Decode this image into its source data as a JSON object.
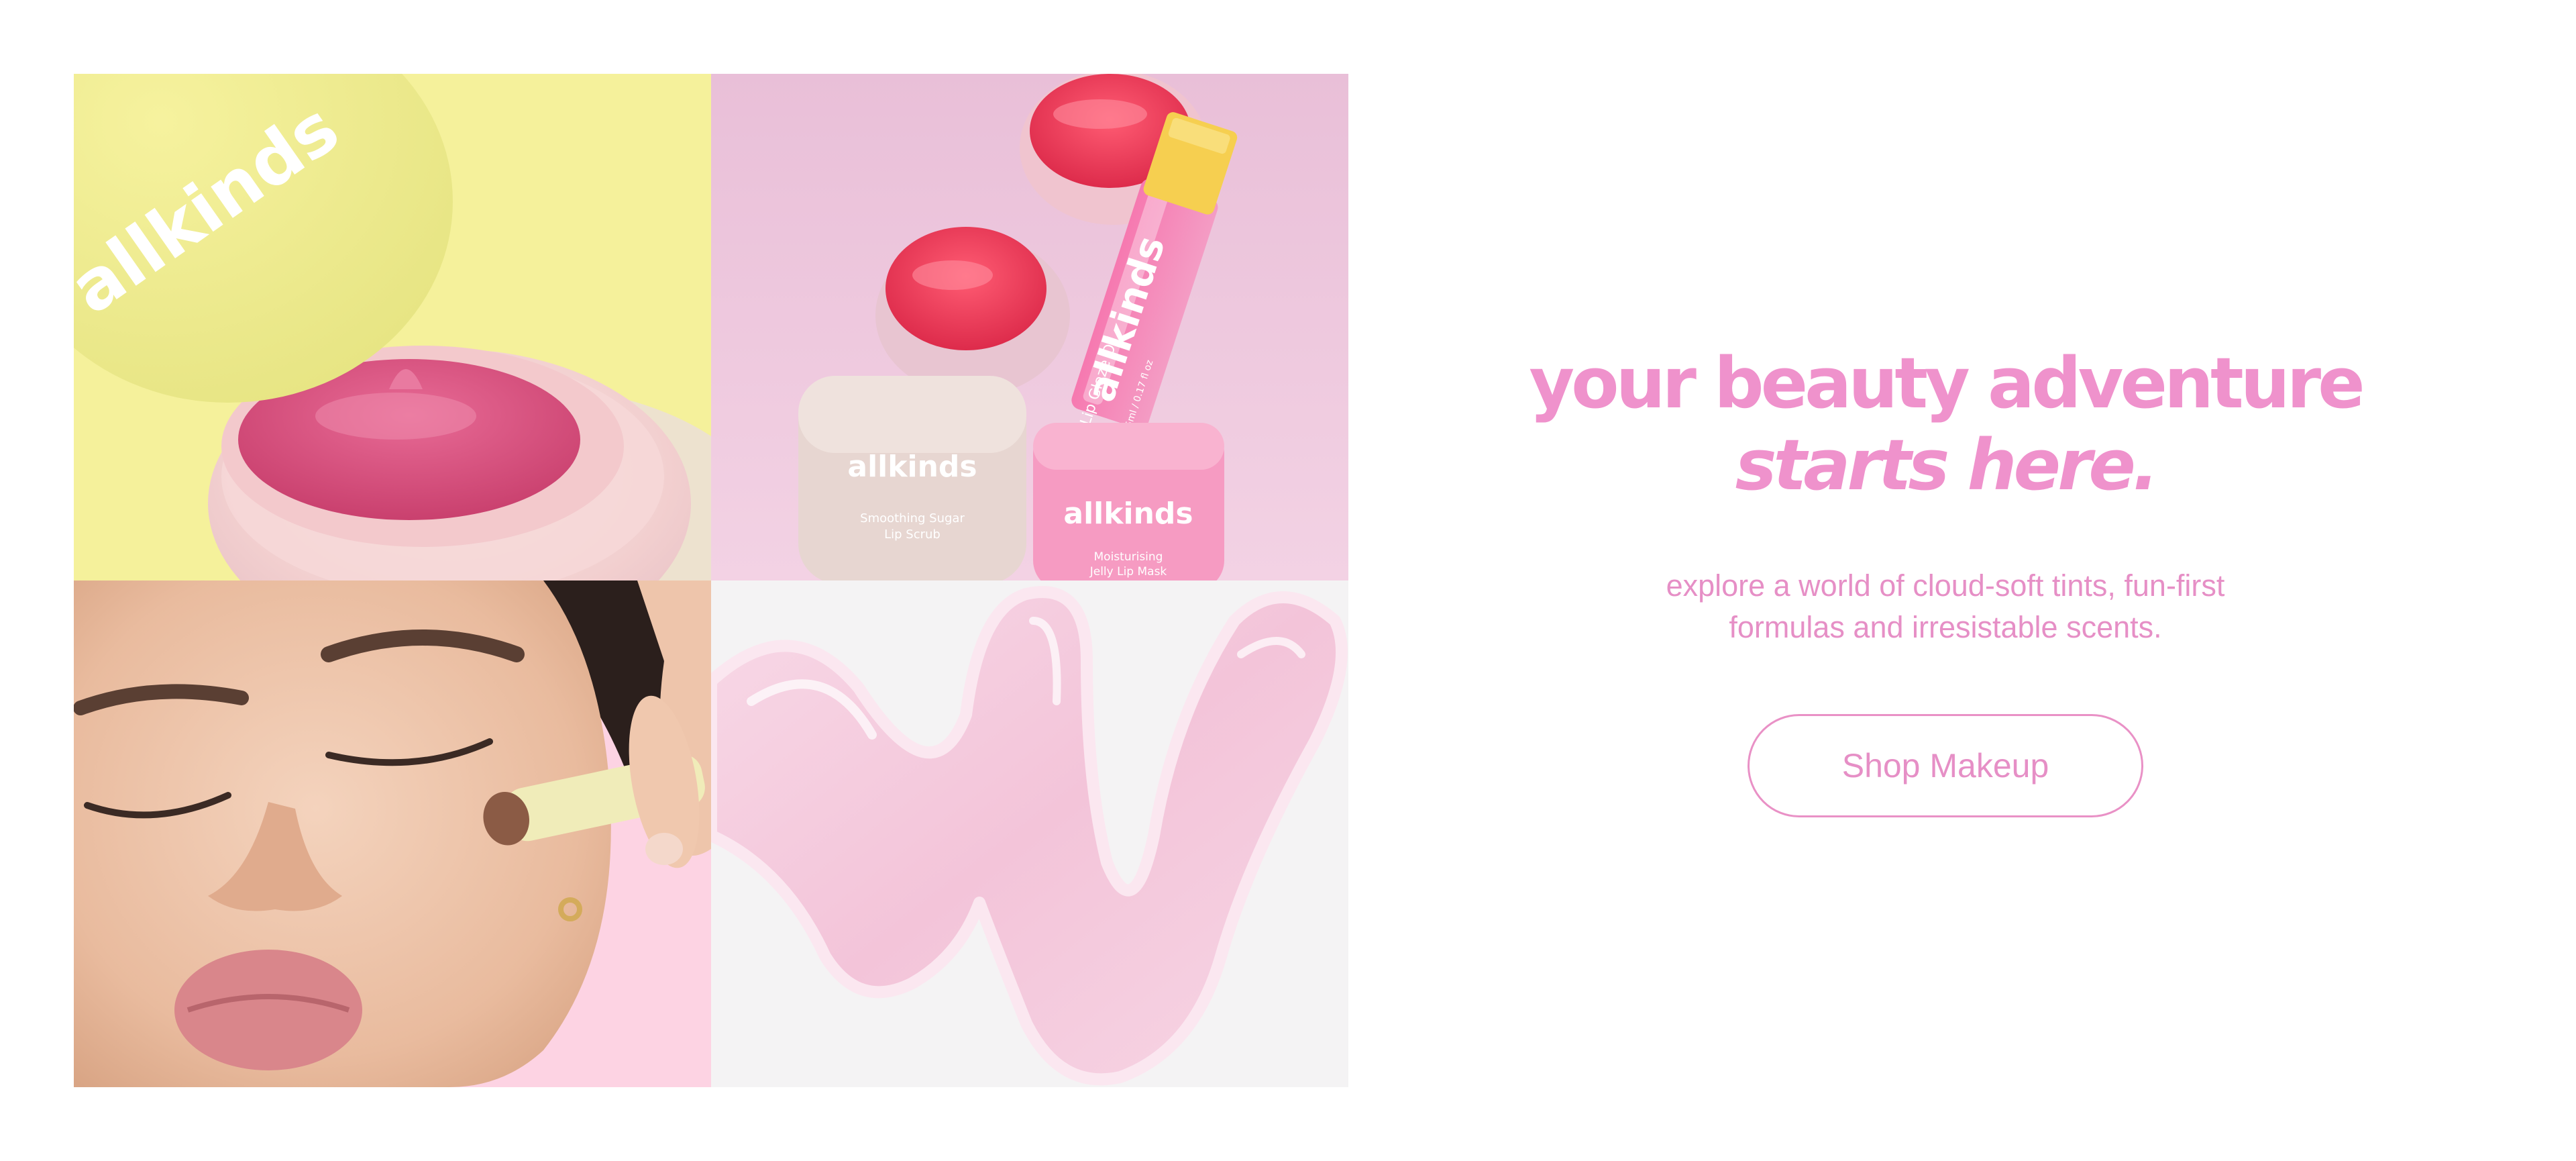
{
  "mosaic": {
    "jar_tile": {
      "brand": "allkinds"
    },
    "products_tile": {
      "brand": "allkinds",
      "oil_label": "Lip Glaze Oil",
      "oil_size": "5ml / 0.17 fl oz",
      "scrub_name_line1": "Smoothing Sugar",
      "scrub_name_line2": "Lip Scrub",
      "mask_name_line1": "Moisturising",
      "mask_name_line2": "Jelly Lip Mask"
    }
  },
  "hero": {
    "headline_line1": "your beauty adventure",
    "headline_line2": "starts here.",
    "subtitle_line1": "explore a world of cloud-soft tints, fun-first",
    "subtitle_line2": "formulas and irresistable scents.",
    "cta_label": "Shop Makeup"
  },
  "colors": {
    "accent_pink": "#ef92cc",
    "tile_yellow": "#f5f19b",
    "tile_lilac": "#eec3dc",
    "tile_pink": "#fdd3e3",
    "tile_grey": "#f4f3f4"
  }
}
